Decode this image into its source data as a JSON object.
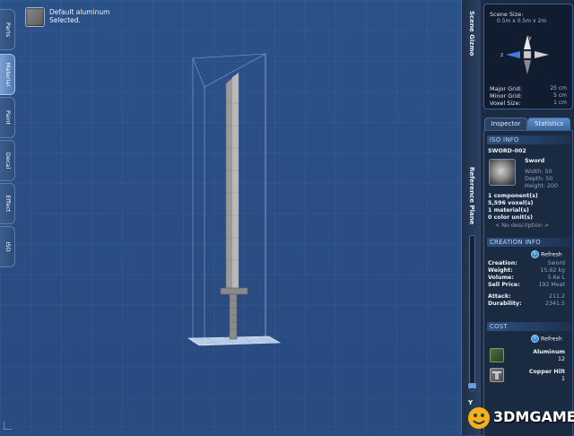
{
  "material": {
    "line1": "Default aluminum",
    "line2": "Selected."
  },
  "left_tabs": [
    {
      "label": "Parts"
    },
    {
      "label": "Material",
      "active": true
    },
    {
      "label": "Paint"
    },
    {
      "label": "Decal"
    },
    {
      "label": "Effect"
    },
    {
      "label": "ISO"
    }
  ],
  "rail": {
    "scene_gizmo": "Scene Gizmo",
    "reference_plane": "Reference Plane",
    "axis_y": "Y"
  },
  "gizmo": {
    "scene_size_label": "Scene Size:",
    "scene_size_value": "0.5m x 0.5m x 2m",
    "axis_y": "y",
    "axis_z": "z",
    "major_grid_label": "Major Grid:",
    "major_grid_value": "25 cm",
    "minor_grid_label": "Minor Grid:",
    "minor_grid_value": "5 cm",
    "voxel_size_label": "Voxel Size:",
    "voxel_size_value": "1 cm"
  },
  "tabs": {
    "inspector": "Inspector",
    "statistics": "Statistics",
    "active": "statistics"
  },
  "iso_info": {
    "header": "ISO INFO",
    "name": "SWORD-002",
    "type": "Sword",
    "width": "Width: 50",
    "depth": "Depth: 50",
    "height": "Height: 200",
    "components": "1 component(s)",
    "voxels": "5,596 voxel(s)",
    "materials": "1 material(s)",
    "color_units": "0 color unit(s)",
    "description": "< No description >"
  },
  "creation_info": {
    "header": "CREATION INFO",
    "refresh": "Refresh",
    "rows": [
      {
        "label": "Creation:",
        "value": "Sword"
      },
      {
        "label": "Weight:",
        "value": "15.62 kg"
      },
      {
        "label": "Volume:",
        "value": "5.6e L"
      },
      {
        "label": "Sell Price:",
        "value": "192 Meat"
      }
    ],
    "stats": [
      {
        "label": "Attack:",
        "value": "211.2"
      },
      {
        "label": "Durability:",
        "value": "2341.5"
      }
    ]
  },
  "cost": {
    "header": "COST",
    "refresh": "Refresh",
    "items": [
      {
        "name": "Aluminum",
        "qty": "12",
        "color": "#3e5a34"
      },
      {
        "name": "Copper Hilt",
        "qty": "1",
        "color": "#6b6b6b"
      }
    ]
  },
  "watermark": "3DMGAME",
  "colors": {
    "viewport": "#2a4f86",
    "panel": "#1c2c44",
    "accent": "#5f8fcb"
  }
}
